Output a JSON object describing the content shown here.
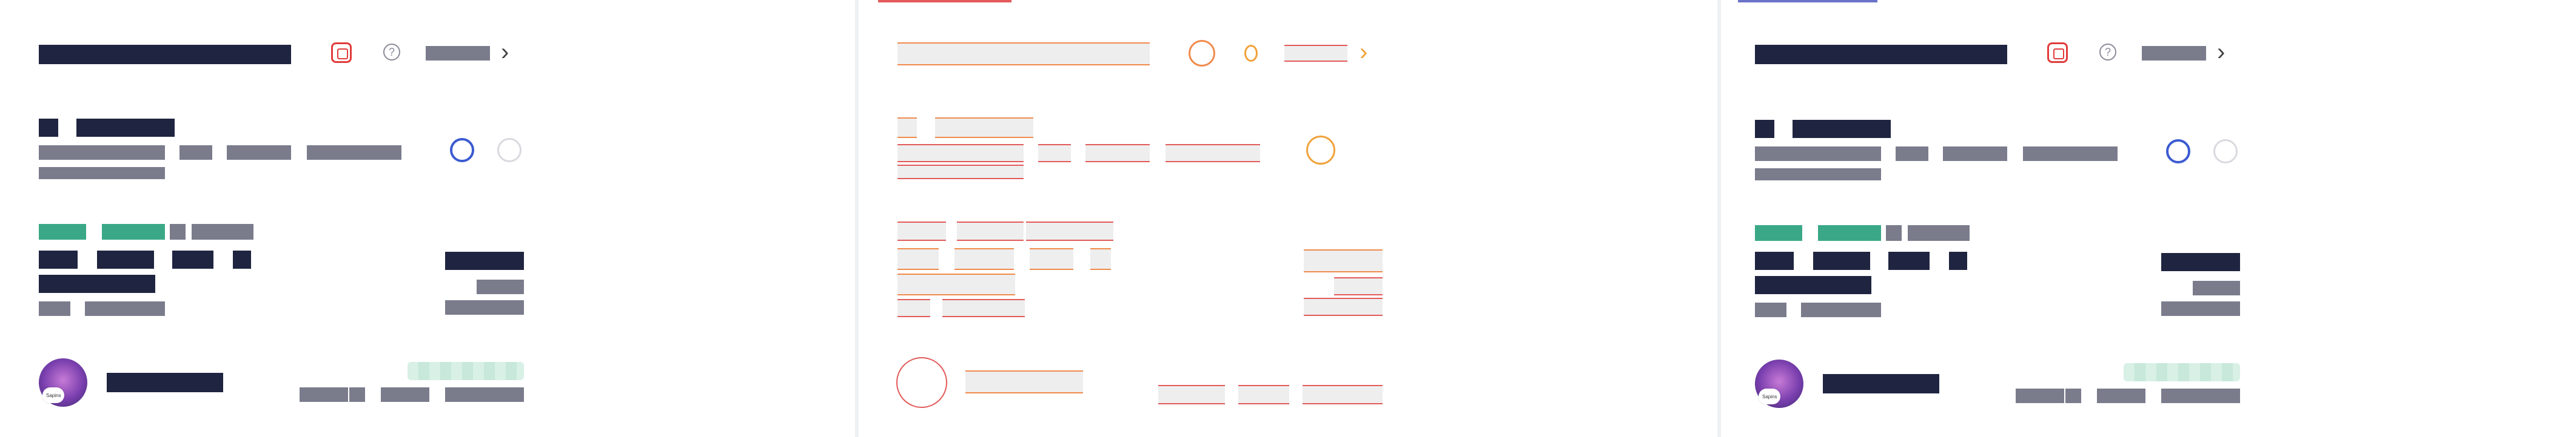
{
  "panels": [
    {
      "id": "left",
      "variant": "rendered"
    },
    {
      "id": "middle",
      "variant": "wireframe"
    },
    {
      "id": "right",
      "variant": "rendered"
    }
  ],
  "avatar_badge": {
    "left": "Sapins",
    "right": "Sapins"
  },
  "colors": {
    "navy": "#1f2440",
    "gray": "#7a7c8c",
    "green": "#3aa886",
    "accent_red": "#e23b3b",
    "radio_blue": "#3b5bd1",
    "wire_orange": "#f08a4b"
  },
  "icons": [
    "stop-icon",
    "help-icon",
    "chevron-right-icon"
  ],
  "radio_states": {
    "left": [
      "selected",
      "unselected"
    ],
    "right": [
      "selected",
      "unselected"
    ]
  }
}
